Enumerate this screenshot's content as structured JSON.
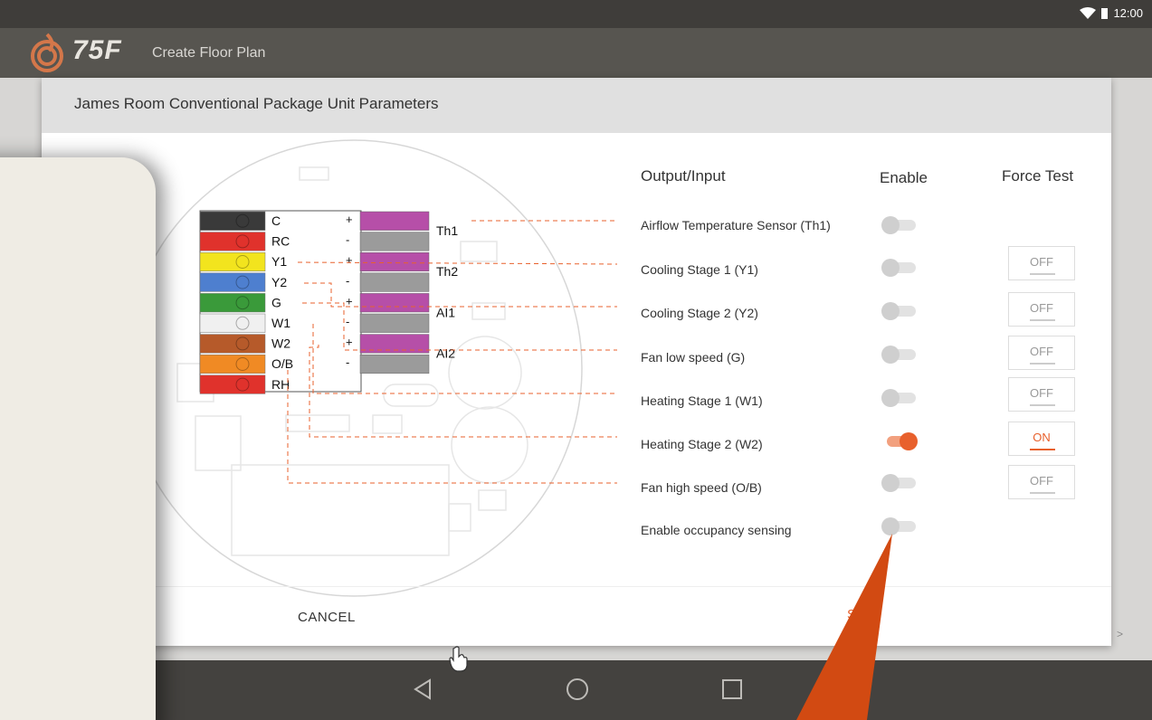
{
  "status": {
    "time": "12:00"
  },
  "app": {
    "brand": "75F",
    "title": "Create Floor Plan"
  },
  "dialog": {
    "title": "James Room Conventional Package Unit Parameters",
    "headers": {
      "output": "Output/Input",
      "enable": "Enable",
      "force": "Force Test"
    },
    "rows": [
      {
        "label": "Airflow Temperature Sensor (Th1)",
        "enabled": false,
        "force": null
      },
      {
        "label": "Cooling Stage 1 (Y1)",
        "enabled": false,
        "force": "OFF"
      },
      {
        "label": "Cooling Stage 2 (Y2)",
        "enabled": false,
        "force": "OFF"
      },
      {
        "label": "Fan low speed (G)",
        "enabled": false,
        "force": "OFF"
      },
      {
        "label": "Heating Stage 1 (W1)",
        "enabled": false,
        "force": "OFF"
      },
      {
        "label": "Heating Stage 2 (W2)",
        "enabled": true,
        "force": "ON"
      },
      {
        "label": "Fan high speed  (O/B)",
        "enabled": false,
        "force": "OFF"
      },
      {
        "label": "Enable occupancy sensing",
        "enabled": false,
        "force": null
      }
    ],
    "cancel_label": "CANCEL",
    "save_fragment": "S"
  },
  "terminals": {
    "left": [
      "C",
      "RC",
      "Y1",
      "Y2",
      "G",
      "W1",
      "W2",
      "O/B",
      "RH"
    ],
    "right": [
      "Th1",
      "Th2",
      "AI1",
      "AI2"
    ],
    "signs": [
      "+",
      "-",
      "+",
      "-",
      "+",
      "-",
      "+",
      "-"
    ]
  },
  "nav": {
    "overflow": ">"
  },
  "colors": {
    "accent": "#e8602c",
    "toggle_off": "#cfcfcf"
  }
}
